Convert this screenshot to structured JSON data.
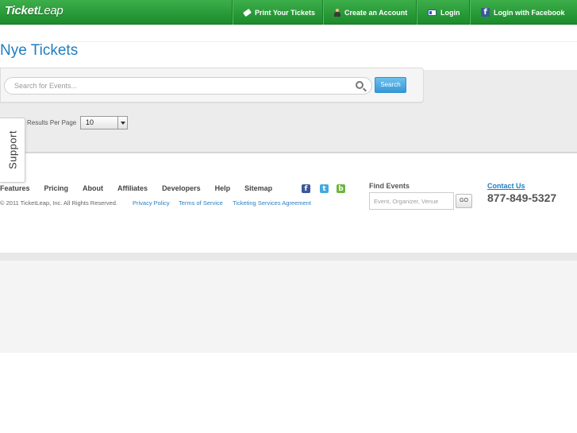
{
  "header": {
    "logo_main": "Ticket",
    "logo_accent": "Leap",
    "nav": {
      "print": "Print Your Tickets",
      "account": "Create an Account",
      "login": "Login",
      "facebook": "Login with Facebook"
    }
  },
  "page": {
    "title": "Nye Tickets"
  },
  "search": {
    "placeholder": "Search for Events...",
    "button": "Search",
    "results_per_page_label": "Results Per Page",
    "results_per_page_value": "10"
  },
  "support": {
    "label": "Support"
  },
  "footer": {
    "links": [
      "Features",
      "Pricing",
      "About",
      "Affiliates",
      "Developers",
      "Help",
      "Sitemap"
    ],
    "copyright": "© 2011 TicketLeap, Inc. All Rights Reserved.",
    "privacy": "Privacy Policy",
    "terms": "Terms of Service",
    "ticketing": "Ticketing Services Agreement",
    "find_events_label": "Find Events",
    "find_events_placeholder": "Event, Organizer, Venue",
    "go": "GO",
    "contact": "Contact Us",
    "phone": "877-849-5327",
    "social_icons": [
      "facebook-icon",
      "twitter-icon",
      "blog-icon"
    ]
  }
}
